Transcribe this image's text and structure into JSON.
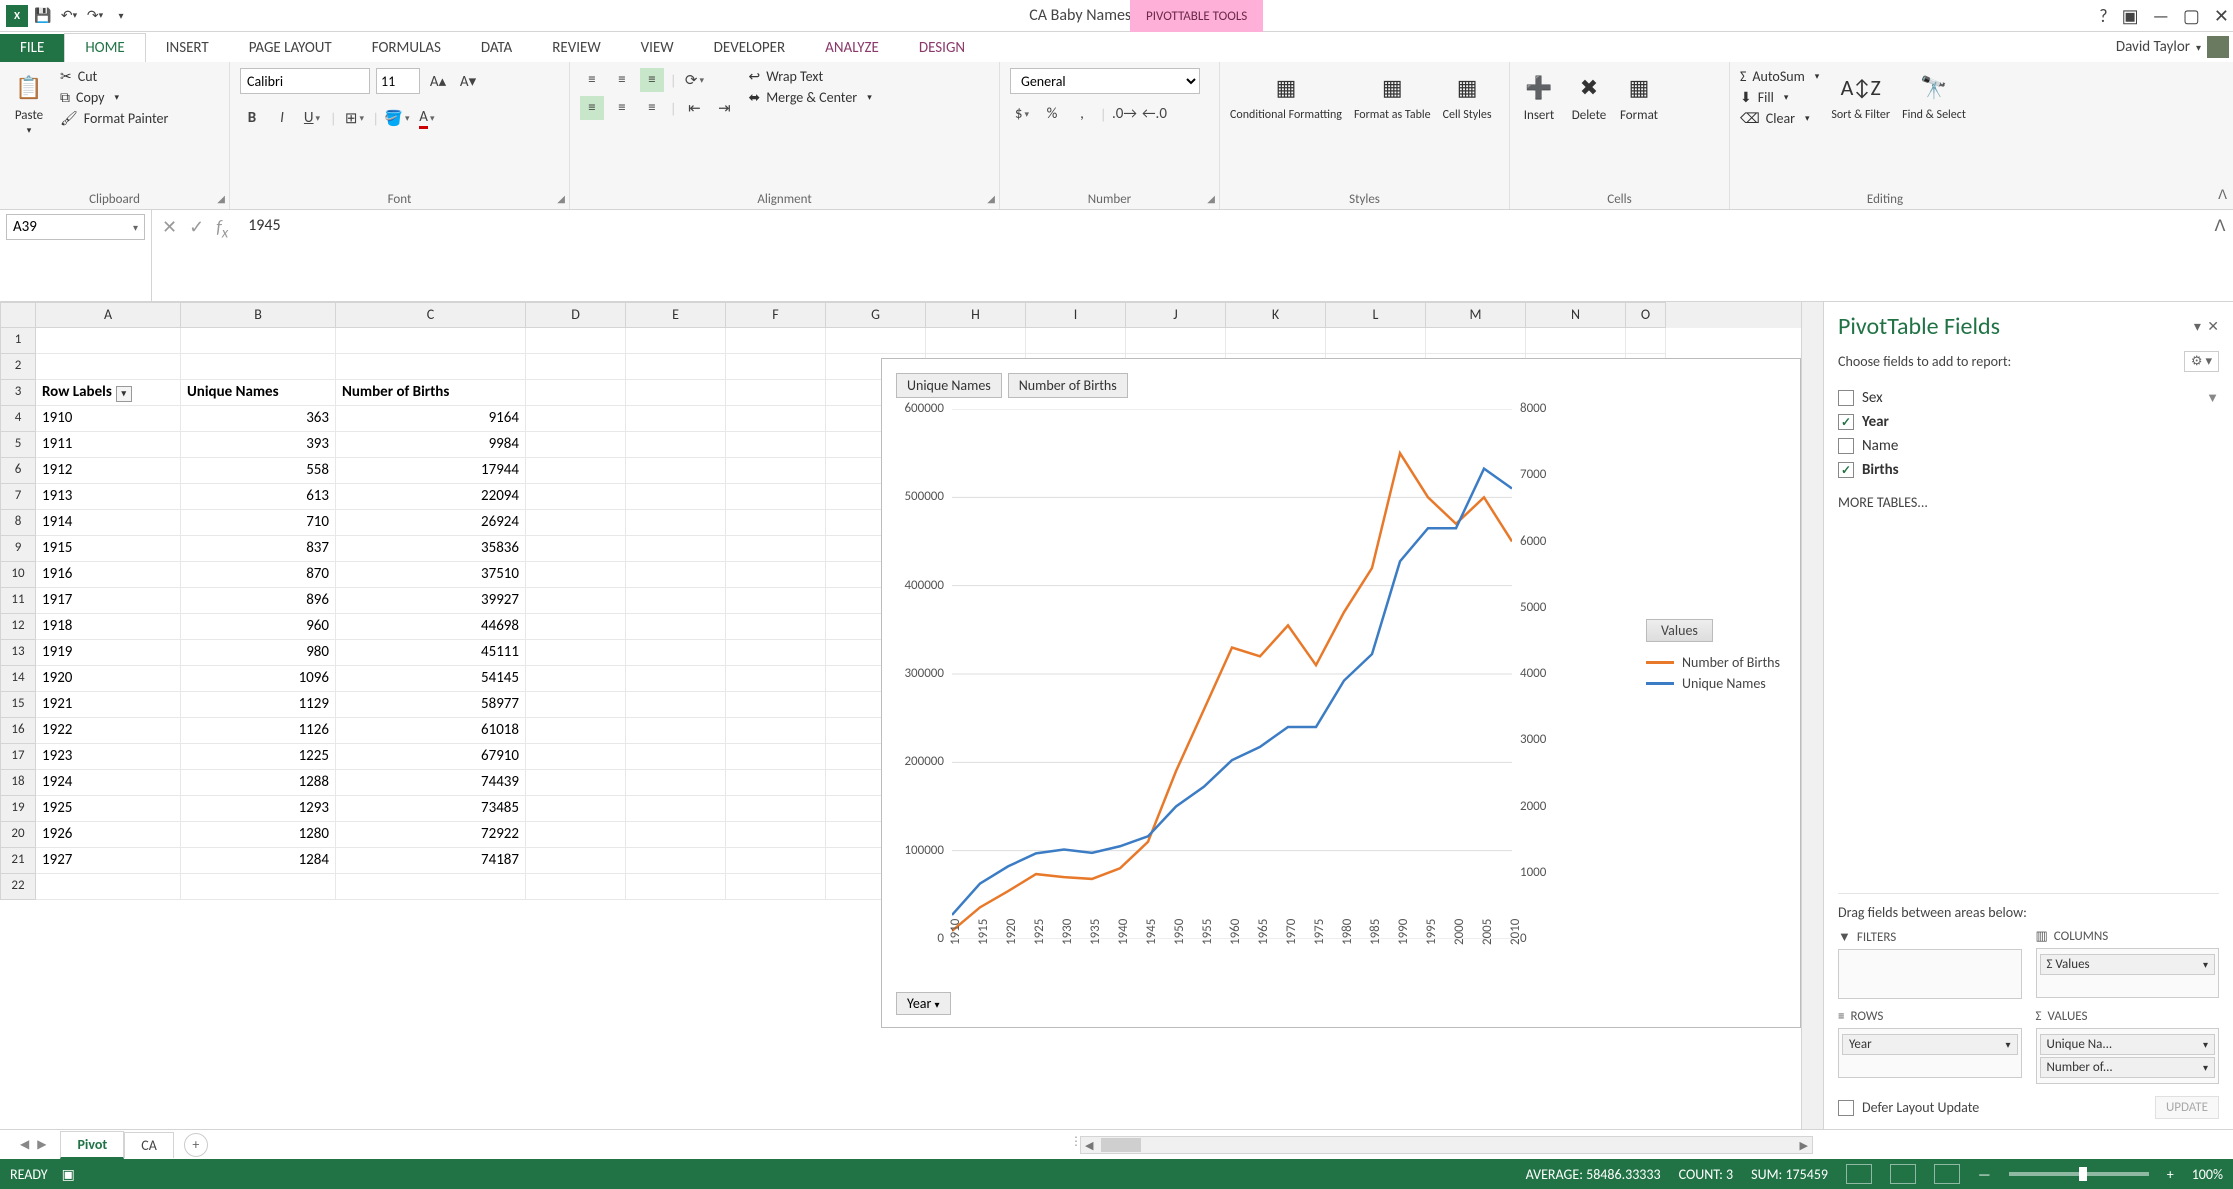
{
  "titlebar": {
    "app_icon_text": "X",
    "doc_title": "CA Baby Names.xlsx - Excel",
    "contextual_tab_group": "PIVOTTABLE TOOLS",
    "user_name": "David Taylor"
  },
  "ribbon_tabs": [
    "FILE",
    "HOME",
    "INSERT",
    "PAGE LAYOUT",
    "FORMULAS",
    "DATA",
    "REVIEW",
    "VIEW",
    "DEVELOPER",
    "ANALYZE",
    "DESIGN"
  ],
  "ribbon": {
    "clipboard": {
      "paste": "Paste",
      "cut": "Cut",
      "copy": "Copy",
      "format_painter": "Format Painter",
      "label": "Clipboard"
    },
    "font": {
      "name": "Calibri",
      "size": "11",
      "label": "Font"
    },
    "alignment": {
      "wrap": "Wrap Text",
      "merge": "Merge & Center",
      "label": "Alignment"
    },
    "number": {
      "format": "General",
      "label": "Number"
    },
    "styles": {
      "cond": "Conditional Formatting",
      "fmt_table": "Format as Table",
      "cell_styles": "Cell Styles",
      "label": "Styles"
    },
    "cells": {
      "insert": "Insert",
      "delete": "Delete",
      "format": "Format",
      "label": "Cells"
    },
    "editing": {
      "autosum": "AutoSum",
      "fill": "Fill",
      "clear": "Clear",
      "sort": "Sort & Filter",
      "find": "Find & Select",
      "label": "Editing"
    }
  },
  "formula_bar": {
    "namebox": "A39",
    "formula": "1945"
  },
  "columns": [
    "A",
    "B",
    "C",
    "D",
    "E",
    "F",
    "G",
    "H",
    "I",
    "J",
    "K",
    "L",
    "M",
    "N",
    "O"
  ],
  "headers": {
    "row_labels": "Row Labels",
    "col_b": "Unique Names",
    "col_c": "Number of Births"
  },
  "rows": [
    {
      "r": 4,
      "year": "1910",
      "unique": 363,
      "births": 9164
    },
    {
      "r": 5,
      "year": "1911",
      "unique": 393,
      "births": 9984
    },
    {
      "r": 6,
      "year": "1912",
      "unique": 558,
      "births": 17944
    },
    {
      "r": 7,
      "year": "1913",
      "unique": 613,
      "births": 22094
    },
    {
      "r": 8,
      "year": "1914",
      "unique": 710,
      "births": 26924
    },
    {
      "r": 9,
      "year": "1915",
      "unique": 837,
      "births": 35836
    },
    {
      "r": 10,
      "year": "1916",
      "unique": 870,
      "births": 37510
    },
    {
      "r": 11,
      "year": "1917",
      "unique": 896,
      "births": 39927
    },
    {
      "r": 12,
      "year": "1918",
      "unique": 960,
      "births": 44698
    },
    {
      "r": 13,
      "year": "1919",
      "unique": 980,
      "births": 45111
    },
    {
      "r": 14,
      "year": "1920",
      "unique": 1096,
      "births": 54145
    },
    {
      "r": 15,
      "year": "1921",
      "unique": 1129,
      "births": 58977
    },
    {
      "r": 16,
      "year": "1922",
      "unique": 1126,
      "births": 61018
    },
    {
      "r": 17,
      "year": "1923",
      "unique": 1225,
      "births": 67910
    },
    {
      "r": 18,
      "year": "1924",
      "unique": 1288,
      "births": 74439
    },
    {
      "r": 19,
      "year": "1925",
      "unique": 1293,
      "births": 73485
    },
    {
      "r": 20,
      "year": "1926",
      "unique": 1280,
      "births": 72922
    },
    {
      "r": 21,
      "year": "1927",
      "unique": 1284,
      "births": 74187
    }
  ],
  "chart": {
    "btn1": "Unique Names",
    "btn2": "Number of Births",
    "legend_title": "Values",
    "legend1": "Number of Births",
    "legend2": "Unique Names",
    "year_btn": "Year",
    "y1_ticks": [
      "0",
      "100000",
      "200000",
      "300000",
      "400000",
      "500000",
      "600000"
    ],
    "y2_ticks": [
      "0",
      "1000",
      "2000",
      "3000",
      "4000",
      "5000",
      "6000",
      "7000",
      "8000"
    ],
    "x_ticks": [
      "1910",
      "1915",
      "1920",
      "1925",
      "1930",
      "1935",
      "1940",
      "1945",
      "1950",
      "1955",
      "1960",
      "1965",
      "1970",
      "1975",
      "1980",
      "1985",
      "1990",
      "1995",
      "2000",
      "2005",
      "2010"
    ]
  },
  "chart_data": {
    "type": "line",
    "title": "",
    "xlabel": "Year",
    "y1_label": "Number of Births",
    "y2_label": "Unique Names",
    "x": [
      1910,
      1915,
      1920,
      1925,
      1930,
      1935,
      1940,
      1945,
      1950,
      1955,
      1960,
      1965,
      1970,
      1975,
      1980,
      1985,
      1990,
      1995,
      2000,
      2005,
      2010
    ],
    "series": [
      {
        "name": "Number of Births",
        "axis": "left",
        "color": "#e8792a",
        "values": [
          9164,
          35836,
          54145,
          73485,
          70000,
          68000,
          80000,
          110000,
          190000,
          260000,
          330000,
          320000,
          355000,
          310000,
          370000,
          420000,
          550000,
          500000,
          470000,
          500000,
          450000
        ]
      },
      {
        "name": "Unique Names",
        "axis": "right",
        "color": "#3b7cc4",
        "values": [
          363,
          837,
          1096,
          1293,
          1350,
          1300,
          1400,
          1550,
          2000,
          2300,
          2700,
          2900,
          3200,
          3200,
          3900,
          4300,
          5700,
          6200,
          6200,
          7100,
          6800
        ]
      }
    ],
    "y1_lim": [
      0,
      600000
    ],
    "y2_lim": [
      0,
      8000
    ]
  },
  "pane": {
    "title": "PivotTable Fields",
    "subtitle": "Choose fields to add to report:",
    "fields": [
      {
        "name": "Sex",
        "checked": false,
        "filter": true
      },
      {
        "name": "Year",
        "checked": true
      },
      {
        "name": "Name",
        "checked": false
      },
      {
        "name": "Births",
        "checked": true
      }
    ],
    "more": "MORE TABLES...",
    "drag_label": "Drag fields between areas below:",
    "filters_label": "FILTERS",
    "columns_label": "COLUMNS",
    "rows_label": "ROWS",
    "values_label": "VALUES",
    "columns_chip": "Σ Values",
    "rows_chip": "Year",
    "values_chip1": "Unique Na...",
    "values_chip2": "Number of...",
    "defer": "Defer Layout Update",
    "update": "UPDATE"
  },
  "sheets": {
    "tab1": "Pivot",
    "tab2": "CA"
  },
  "statusbar": {
    "ready": "READY",
    "avg": "AVERAGE: 58486.33333",
    "count": "COUNT: 3",
    "sum": "SUM: 175459",
    "zoom": "100%"
  }
}
